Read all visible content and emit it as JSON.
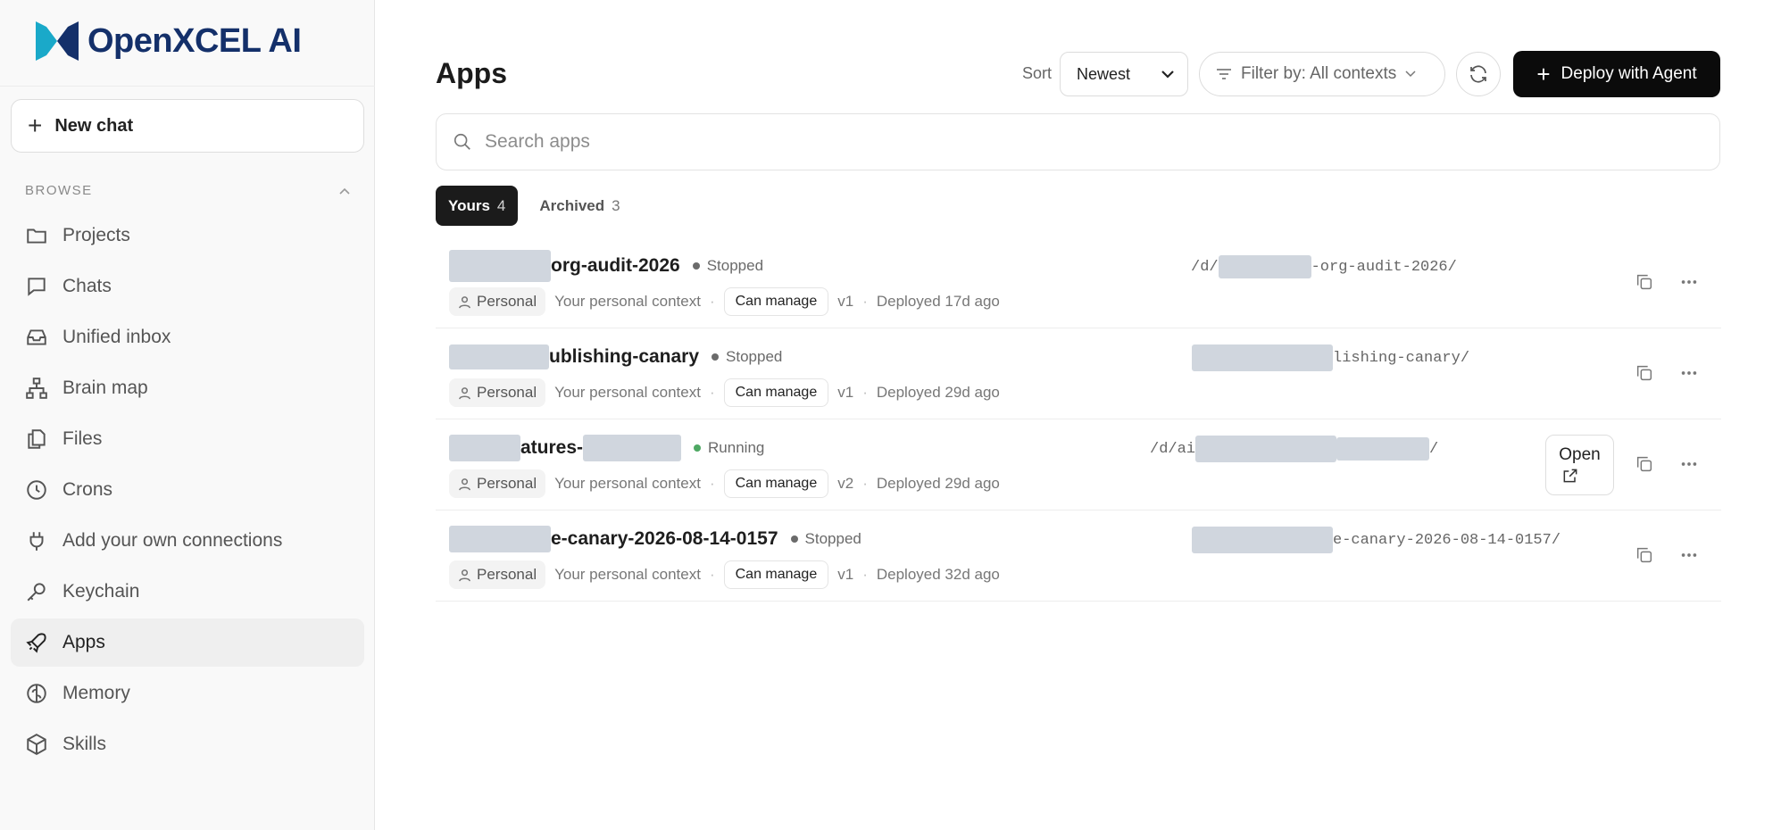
{
  "brand": {
    "name": "OpenXCEL AI"
  },
  "sidebar": {
    "new_chat_label": "New chat",
    "browse_label": "BROWSE",
    "items": [
      {
        "label": "Projects",
        "icon": "folder-icon"
      },
      {
        "label": "Chats",
        "icon": "chat-icon"
      },
      {
        "label": "Unified inbox",
        "icon": "inbox-icon"
      },
      {
        "label": "Brain map",
        "icon": "hierarchy-icon"
      },
      {
        "label": "Files",
        "icon": "files-icon"
      },
      {
        "label": "Crons",
        "icon": "clock-icon"
      },
      {
        "label": "Add your own connections",
        "icon": "plug-icon"
      },
      {
        "label": "Keychain",
        "icon": "key-icon"
      },
      {
        "label": "Apps",
        "icon": "rocket-icon",
        "active": true
      },
      {
        "label": "Memory",
        "icon": "brain-icon"
      },
      {
        "label": "Skills",
        "icon": "cube-icon"
      }
    ]
  },
  "main": {
    "title": "Apps",
    "sort_label": "Sort",
    "sort_value": "Newest",
    "filter_label": "Filter by: All contexts",
    "deploy_label": "Deploy with Agent",
    "search_placeholder": "Search apps",
    "tabs": [
      {
        "label": "Yours",
        "count": "4",
        "active": true
      },
      {
        "label": "Archived",
        "count": "3",
        "active": false
      }
    ],
    "apps": [
      {
        "name": "org-audit-2026",
        "status": "Stopped",
        "context_pill": "Personal",
        "context": "Your personal context",
        "permission": "Can manage",
        "version": "v1",
        "deployed": "Deployed 17d ago",
        "path_prefix": "/d/",
        "path_suffix": "-org-audit-2026/"
      },
      {
        "name": "ublishing-canary",
        "status": "Stopped",
        "context_pill": "Personal",
        "context": "Your personal context",
        "permission": "Can manage",
        "version": "v1",
        "deployed": "Deployed 29d ago",
        "path_prefix": "",
        "path_suffix": "lishing-canary/"
      },
      {
        "name": "atures-",
        "status": "Running",
        "context_pill": "Personal",
        "context": "Your personal context",
        "permission": "Can manage",
        "version": "v2",
        "deployed": "Deployed 29d ago",
        "path_prefix": "/d/ai",
        "path_suffix": "/",
        "open_label": "Open"
      },
      {
        "name": "e-canary-2026-08-14-0157",
        "status": "Stopped",
        "context_pill": "Personal",
        "context": "Your personal context",
        "permission": "Can manage",
        "version": "v1",
        "deployed": "Deployed 32d ago",
        "path_prefix": "",
        "path_suffix": "e-canary-2026-08-14-0157/"
      }
    ],
    "separator": "·"
  }
}
